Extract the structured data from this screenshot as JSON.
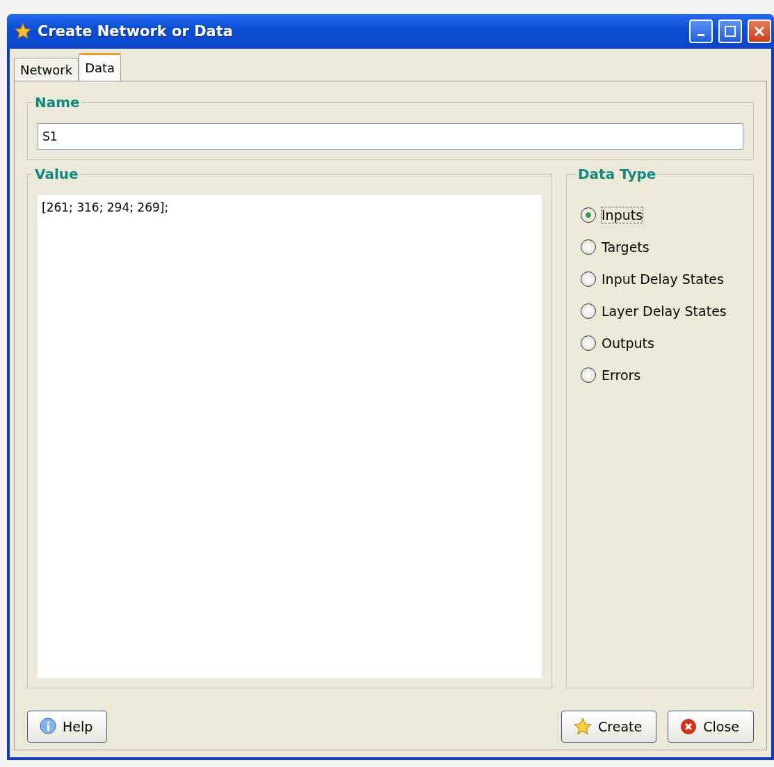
{
  "window": {
    "title": "Create Network or Data"
  },
  "tabs": [
    {
      "label": "Network",
      "selected": false
    },
    {
      "label": "Data",
      "selected": true
    }
  ],
  "name_group": {
    "title": "Name",
    "value": "S1"
  },
  "value_group": {
    "title": "Value",
    "value": "[261; 316; 294; 269];"
  },
  "data_type": {
    "title": "Data Type",
    "options": [
      {
        "label": "Inputs",
        "selected": true
      },
      {
        "label": "Targets",
        "selected": false
      },
      {
        "label": "Input Delay States",
        "selected": false
      },
      {
        "label": "Layer Delay States",
        "selected": false
      },
      {
        "label": "Outputs",
        "selected": false
      },
      {
        "label": "Errors",
        "selected": false
      }
    ]
  },
  "buttons": [
    {
      "kind": "help",
      "label": "Help"
    },
    {
      "kind": "create",
      "label": "Create"
    },
    {
      "kind": "close",
      "label": "Close"
    }
  ]
}
